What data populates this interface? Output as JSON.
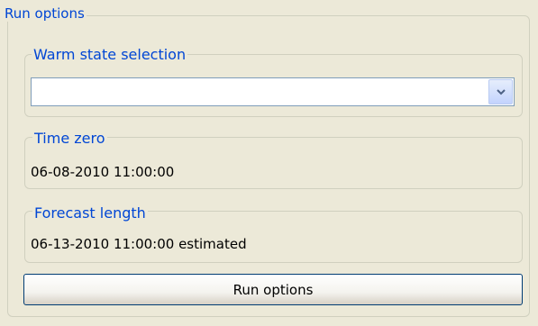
{
  "run_options_group": {
    "title": "Run options"
  },
  "warm_state": {
    "title": "Warm state selection",
    "selected_value": "",
    "dropdown_icon": "chevron-down-icon"
  },
  "time_zero": {
    "title": "Time zero",
    "value": "06-08-2010 11:00:00"
  },
  "forecast_length": {
    "title": "Forecast length",
    "value": "06-13-2010 11:00:00 estimated"
  },
  "run_button": {
    "label": "Run options"
  },
  "colors": {
    "panel_background": "#ece9d8",
    "group_title": "#0046d5",
    "group_border": "#d0d0bf",
    "input_border": "#7f9db9",
    "button_border": "#003c74"
  }
}
